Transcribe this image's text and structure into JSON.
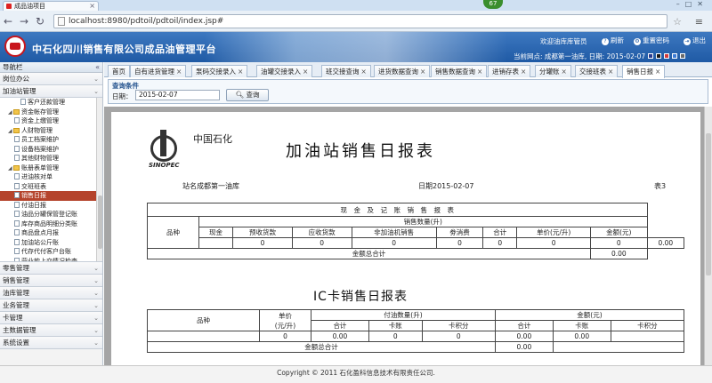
{
  "browser": {
    "tab_title": "成品油项目",
    "badge": "67",
    "url": "localhost:8980/pdtoil/pdtoil/index.jsp#"
  },
  "header": {
    "app_title": "中石化四川销售有限公司成品油管理平台",
    "welcome": "欢迎油库库管员",
    "refresh": "刷新",
    "reset_password": "重置密码",
    "exit": "退出",
    "current_station": "当前网点: 成都第一油库, 日期: 2015-02-07",
    "theme_colors": [
      "#2a3c8f",
      "#1a1a1a",
      "#d33a3a",
      "#3b7bd6",
      "#6a6a6a"
    ]
  },
  "sidebar": {
    "title": "导航栏",
    "sections_top": [
      "岗位办公",
      "加油站管理"
    ],
    "tree": [
      {
        "label": "客户还款管理",
        "type": "doc",
        "indent": 3
      },
      {
        "label": "资金帐存管理",
        "type": "fold",
        "indent": 1
      },
      {
        "label": "资金上缴管理",
        "type": "doc",
        "indent": 2
      },
      {
        "label": "人财物管理",
        "type": "fold",
        "indent": 1
      },
      {
        "label": "员工档案维护",
        "type": "doc",
        "indent": 2
      },
      {
        "label": "设备档案维护",
        "type": "doc",
        "indent": 2
      },
      {
        "label": "其他财物管理",
        "type": "doc",
        "indent": 2
      },
      {
        "label": "账册表单管理",
        "type": "fold",
        "indent": 1
      },
      {
        "label": "进油核对单",
        "type": "doc",
        "indent": 2
      },
      {
        "label": "交班班表",
        "type": "doc",
        "indent": 2
      },
      {
        "label": "销售日报",
        "type": "doc",
        "indent": 2,
        "selected": true
      },
      {
        "label": "付油日报",
        "type": "doc",
        "indent": 2
      },
      {
        "label": "油品分罐保管登记账",
        "type": "doc",
        "indent": 2
      },
      {
        "label": "库存商品明细分类账",
        "type": "doc",
        "indent": 2
      },
      {
        "label": "商品盘点月报",
        "type": "doc",
        "indent": 2
      },
      {
        "label": "加油站公斤账",
        "type": "doc",
        "indent": 2
      },
      {
        "label": "代存代付客户台账",
        "type": "doc",
        "indent": 2
      },
      {
        "label": "营业款上交情况检查",
        "type": "doc",
        "indent": 2
      }
    ],
    "sections_bottom": [
      "零售管理",
      "销售管理",
      "油库管理",
      "业务管理",
      "卡管理",
      "主数据管理",
      "系统设置"
    ]
  },
  "tabs": [
    {
      "label": "首页",
      "closable": false
    },
    {
      "label": "自有进货管理",
      "closable": true
    },
    {
      "label": "泵码交接录入",
      "closable": true
    },
    {
      "label": "油罐交接录入",
      "closable": true
    },
    {
      "label": "班交接查询",
      "closable": true
    },
    {
      "label": "进货数据查询",
      "closable": true
    },
    {
      "label": "销售数据查询",
      "closable": true
    },
    {
      "label": "进销存表",
      "closable": true
    },
    {
      "label": "分罐账",
      "closable": true
    },
    {
      "label": "交接班表",
      "closable": true
    },
    {
      "label": "销售日报",
      "closable": true,
      "active": true
    }
  ],
  "query": {
    "title": "查询条件",
    "date_label": "日期：",
    "date_value": "2015-02-07",
    "search_button": "查询"
  },
  "report": {
    "company_name": "中国石化",
    "logo_text": "SINOPEC",
    "title": "加油站销售日报表",
    "station_label": "站名成都第一油库",
    "date_label": "日期2015-02-07",
    "table_no": "表3",
    "cash_header": "现　金　及　记　账　销　售　报　表",
    "product_label": "品种",
    "qty_header": "销售数量(升)",
    "cols": [
      "现金",
      "预收货款",
      "应收货款",
      "非加油机销售",
      "劵消费",
      "合计",
      "单价(元/升)",
      "金额(元)"
    ],
    "row_values": [
      "0",
      "0",
      "0",
      "0",
      "0",
      "0",
      "0",
      "0.00"
    ],
    "total_label": "金额总合计",
    "total_value": "0.00",
    "ic_title": "IC卡销售日报表",
    "ic_product": "品种",
    "ic_unit_price": "单价\n(元/升)",
    "ic_qty_header": "付油数量(升)",
    "ic_amount_header": "金额(元)",
    "ic_sub_cols": [
      "合计",
      "卡账",
      "卡积分",
      "合计",
      "卡账",
      "卡积分"
    ],
    "ic_row_values": [
      "0",
      "0.00",
      "0",
      "0",
      "0.00",
      "0.00",
      ""
    ],
    "ic_total_label": "金额总合计",
    "ic_total_value": "0.00"
  },
  "viewer_tools": [
    "fit-page-icon",
    "fit-width-icon",
    "zoom-out-icon",
    "zoom-in-icon",
    "save-icon",
    "print-icon"
  ],
  "footer": {
    "copyright": "Copyright © 2011 石化盈科信息技术有限责任公司."
  }
}
